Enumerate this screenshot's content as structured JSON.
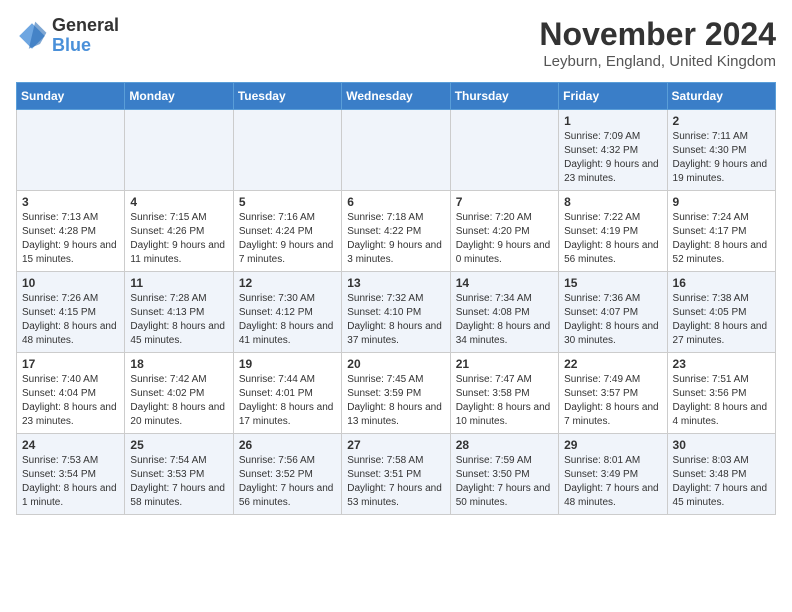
{
  "app": {
    "logo_line1": "General",
    "logo_line2": "Blue"
  },
  "calendar": {
    "title": "November 2024",
    "location": "Leyburn, England, United Kingdom",
    "days_of_week": [
      "Sunday",
      "Monday",
      "Tuesday",
      "Wednesday",
      "Thursday",
      "Friday",
      "Saturday"
    ],
    "rows": [
      [
        {
          "day": "",
          "info": ""
        },
        {
          "day": "",
          "info": ""
        },
        {
          "day": "",
          "info": ""
        },
        {
          "day": "",
          "info": ""
        },
        {
          "day": "",
          "info": ""
        },
        {
          "day": "1",
          "info": "Sunrise: 7:09 AM\nSunset: 4:32 PM\nDaylight: 9 hours and 23 minutes."
        },
        {
          "day": "2",
          "info": "Sunrise: 7:11 AM\nSunset: 4:30 PM\nDaylight: 9 hours and 19 minutes."
        }
      ],
      [
        {
          "day": "3",
          "info": "Sunrise: 7:13 AM\nSunset: 4:28 PM\nDaylight: 9 hours and 15 minutes."
        },
        {
          "day": "4",
          "info": "Sunrise: 7:15 AM\nSunset: 4:26 PM\nDaylight: 9 hours and 11 minutes."
        },
        {
          "day": "5",
          "info": "Sunrise: 7:16 AM\nSunset: 4:24 PM\nDaylight: 9 hours and 7 minutes."
        },
        {
          "day": "6",
          "info": "Sunrise: 7:18 AM\nSunset: 4:22 PM\nDaylight: 9 hours and 3 minutes."
        },
        {
          "day": "7",
          "info": "Sunrise: 7:20 AM\nSunset: 4:20 PM\nDaylight: 9 hours and 0 minutes."
        },
        {
          "day": "8",
          "info": "Sunrise: 7:22 AM\nSunset: 4:19 PM\nDaylight: 8 hours and 56 minutes."
        },
        {
          "day": "9",
          "info": "Sunrise: 7:24 AM\nSunset: 4:17 PM\nDaylight: 8 hours and 52 minutes."
        }
      ],
      [
        {
          "day": "10",
          "info": "Sunrise: 7:26 AM\nSunset: 4:15 PM\nDaylight: 8 hours and 48 minutes."
        },
        {
          "day": "11",
          "info": "Sunrise: 7:28 AM\nSunset: 4:13 PM\nDaylight: 8 hours and 45 minutes."
        },
        {
          "day": "12",
          "info": "Sunrise: 7:30 AM\nSunset: 4:12 PM\nDaylight: 8 hours and 41 minutes."
        },
        {
          "day": "13",
          "info": "Sunrise: 7:32 AM\nSunset: 4:10 PM\nDaylight: 8 hours and 37 minutes."
        },
        {
          "day": "14",
          "info": "Sunrise: 7:34 AM\nSunset: 4:08 PM\nDaylight: 8 hours and 34 minutes."
        },
        {
          "day": "15",
          "info": "Sunrise: 7:36 AM\nSunset: 4:07 PM\nDaylight: 8 hours and 30 minutes."
        },
        {
          "day": "16",
          "info": "Sunrise: 7:38 AM\nSunset: 4:05 PM\nDaylight: 8 hours and 27 minutes."
        }
      ],
      [
        {
          "day": "17",
          "info": "Sunrise: 7:40 AM\nSunset: 4:04 PM\nDaylight: 8 hours and 23 minutes."
        },
        {
          "day": "18",
          "info": "Sunrise: 7:42 AM\nSunset: 4:02 PM\nDaylight: 8 hours and 20 minutes."
        },
        {
          "day": "19",
          "info": "Sunrise: 7:44 AM\nSunset: 4:01 PM\nDaylight: 8 hours and 17 minutes."
        },
        {
          "day": "20",
          "info": "Sunrise: 7:45 AM\nSunset: 3:59 PM\nDaylight: 8 hours and 13 minutes."
        },
        {
          "day": "21",
          "info": "Sunrise: 7:47 AM\nSunset: 3:58 PM\nDaylight: 8 hours and 10 minutes."
        },
        {
          "day": "22",
          "info": "Sunrise: 7:49 AM\nSunset: 3:57 PM\nDaylight: 8 hours and 7 minutes."
        },
        {
          "day": "23",
          "info": "Sunrise: 7:51 AM\nSunset: 3:56 PM\nDaylight: 8 hours and 4 minutes."
        }
      ],
      [
        {
          "day": "24",
          "info": "Sunrise: 7:53 AM\nSunset: 3:54 PM\nDaylight: 8 hours and 1 minute."
        },
        {
          "day": "25",
          "info": "Sunrise: 7:54 AM\nSunset: 3:53 PM\nDaylight: 7 hours and 58 minutes."
        },
        {
          "day": "26",
          "info": "Sunrise: 7:56 AM\nSunset: 3:52 PM\nDaylight: 7 hours and 56 minutes."
        },
        {
          "day": "27",
          "info": "Sunrise: 7:58 AM\nSunset: 3:51 PM\nDaylight: 7 hours and 53 minutes."
        },
        {
          "day": "28",
          "info": "Sunrise: 7:59 AM\nSunset: 3:50 PM\nDaylight: 7 hours and 50 minutes."
        },
        {
          "day": "29",
          "info": "Sunrise: 8:01 AM\nSunset: 3:49 PM\nDaylight: 7 hours and 48 minutes."
        },
        {
          "day": "30",
          "info": "Sunrise: 8:03 AM\nSunset: 3:48 PM\nDaylight: 7 hours and 45 minutes."
        }
      ]
    ]
  }
}
